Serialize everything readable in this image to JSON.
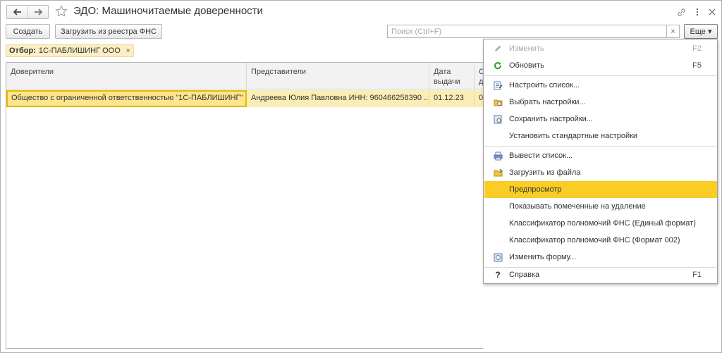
{
  "window": {
    "title": "ЭДО: Машиночитаемые доверенности"
  },
  "toolbar": {
    "create_label": "Создать",
    "load_fns_label": "Загрузить из реестра ФНС",
    "search_placeholder": "Поиск (Ctrl+F)",
    "search_clear": "×",
    "more_label": "Еще ▾"
  },
  "filter": {
    "label": "Отбор:",
    "value": "1С-ПАБЛИШИНГ ООО",
    "close": "×"
  },
  "table": {
    "columns": [
      "Доверители",
      "Представители",
      "Дата\nвыдачи",
      "С\nд"
    ],
    "rows": [
      {
        "principal": "Общество с ограниченной ответственностью \"1С-ПАБЛИШИНГ\" ...",
        "representative": "Андреева Юлия Павловна ИНН: 960466258390 ...",
        "issue_date": "01.12.23",
        "extra": "0"
      }
    ]
  },
  "menu": {
    "items": [
      {
        "label": "Изменить",
        "shortcut": "F2",
        "icon": "pencil-icon",
        "disabled": true
      },
      {
        "label": "Обновить",
        "shortcut": "F5",
        "icon": "refresh-icon"
      },
      {
        "label": "Настроить список...",
        "icon": "list-settings-icon"
      },
      {
        "label": "Выбрать настройки...",
        "icon": "folder-gear-icon"
      },
      {
        "label": "Сохранить настройки...",
        "icon": "save-gear-icon"
      },
      {
        "label": "Установить стандартные настройки",
        "icon": ""
      },
      {
        "label": "Вывести список...",
        "icon": "print-list-icon"
      },
      {
        "label": "Загрузить из файла",
        "icon": "folder-load-icon"
      },
      {
        "label": "Предпросмотр",
        "icon": "",
        "highlighted": true
      },
      {
        "label": "Показывать помеченные на удаление",
        "icon": ""
      },
      {
        "label": "Классификатор полномочий ФНС (Единый формат)",
        "icon": ""
      },
      {
        "label": "Классификатор полномочий ФНС (Формат 002)",
        "icon": ""
      },
      {
        "label": "Изменить форму...",
        "icon": "form-edit-icon"
      },
      {
        "label": "Справка",
        "shortcut": "F1",
        "icon": "help-icon"
      }
    ]
  },
  "colors": {
    "selection": "#fbedb6",
    "active_cell_border": "#e8b800",
    "highlight": "#f9cd25",
    "refresh_green": "#2e9a2e"
  }
}
